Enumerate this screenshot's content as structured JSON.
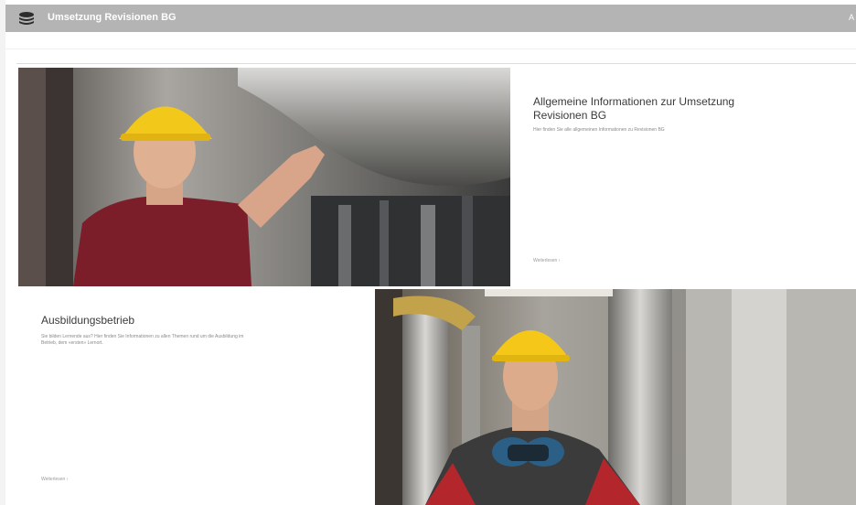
{
  "header": {
    "app_title": "Umsetzung Revisionen BG",
    "user_initial": "A"
  },
  "cards": [
    {
      "title": "Allgemeine Informationen zur Umsetzung Revisionen BG",
      "description": "Hier finden Sie alle allgemeinen Informationen zu Revisionen BG",
      "link_label": "Weiterlesen"
    },
    {
      "title": "Ausbildungsbetrieb",
      "description": "Sie bilden Lernende aus? Hier finden Sie Informationen zu allen Themen rund um die Ausbildung im Betrieb, dem «ersten» Lernort.",
      "link_label": "Weiterlesen"
    }
  ],
  "colors": {
    "topbar": "#b4b4b4",
    "title_text": "#3a3a3a",
    "desc_text": "#8a8a8a"
  }
}
